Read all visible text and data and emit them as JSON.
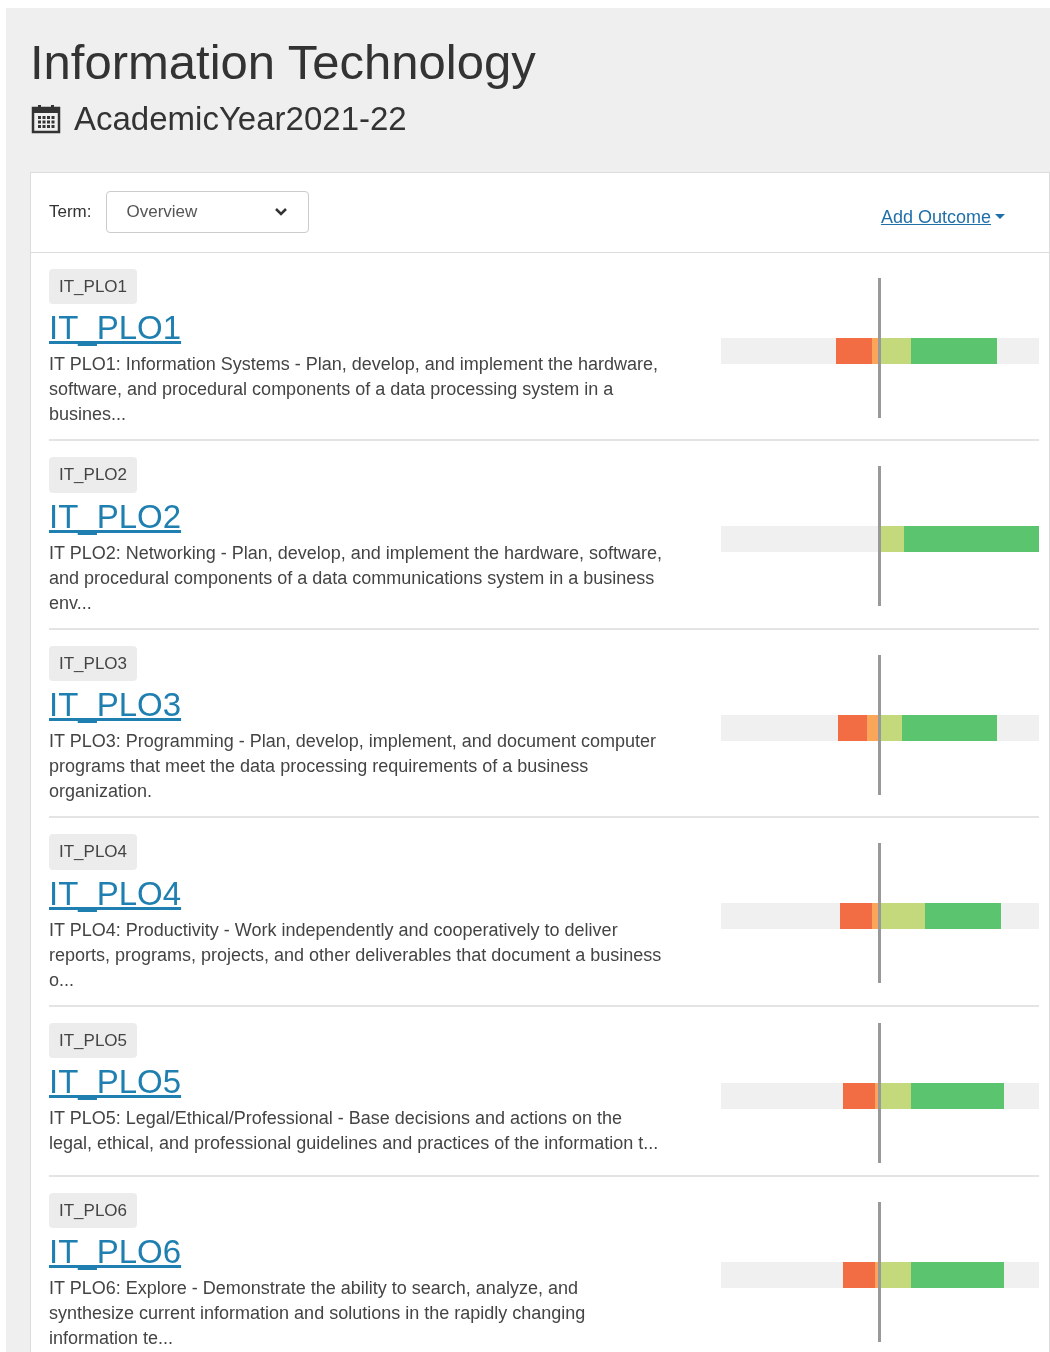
{
  "header": {
    "title": "Information Technology",
    "academic_year": "AcademicYear2021-22"
  },
  "toolbar": {
    "term_label": "Term:",
    "term_value": "Overview",
    "add_outcome": "Add Outcome"
  },
  "outcomes": [
    {
      "tag": "IT_PLO1",
      "name": "IT_PLO1",
      "description": "IT PLO1: Information Systems - Plan, develop, and implement the hardware, software, and procedural components of a data processing system in a busines..."
    },
    {
      "tag": "IT_PLO2",
      "name": "IT_PLO2",
      "description": "IT PLO2: Networking - Plan, develop, and implement the hardware, software, and procedural components of a data communications system in a business env..."
    },
    {
      "tag": "IT_PLO3",
      "name": "IT_PLO3",
      "description": "IT PLO3: Programming - Plan, develop, implement, and document computer programs that meet the data processing requirements of a business organization."
    },
    {
      "tag": "IT_PLO4",
      "name": "IT_PLO4",
      "description": "IT PLO4: Productivity - Work independently and cooperatively to deliver reports, programs, projects, and other deliverables that document a business o..."
    },
    {
      "tag": "IT_PLO5",
      "name": "IT_PLO5",
      "description": "IT PLO5: Legal/Ethical/Professional - Base decisions and actions on the legal, ethical, and professional guidelines and practices of the information t..."
    },
    {
      "tag": "IT_PLO6",
      "name": "IT_PLO6",
      "description": "IT PLO6: Explore - Demonstrate the ability to search, analyze, and synthesize current information and solutions in the rapidly changing information te..."
    }
  ]
}
